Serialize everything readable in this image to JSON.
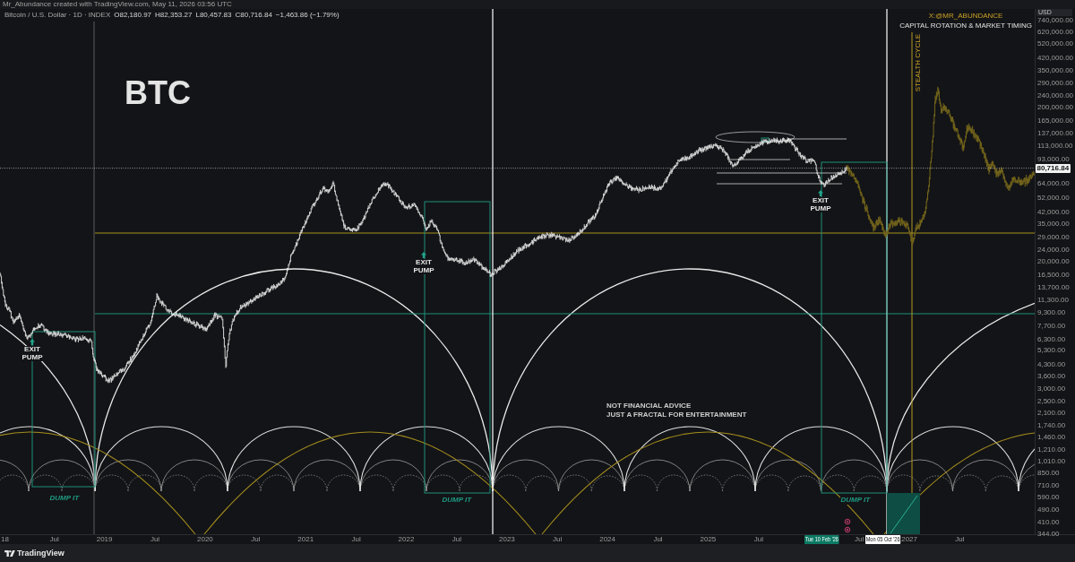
{
  "header": {
    "attribution": "Mr_Abundance created with TradingView.com, May 11, 2026 03:56 UTC"
  },
  "legend": {
    "symbol": "Bitcoin / U.S. Dollar · 1D · INDEX",
    "ohlc": [
      "O82,180.97",
      "H82,353.27",
      "L80,457.83",
      "C80,716.84"
    ],
    "change": "−1,463.86 (−1.79%)"
  },
  "chart": {
    "title": "BTC",
    "handle": "X:@MR_ABUNDANCE",
    "tagline": "CAPITAL ROTATION & MARKET TIMING",
    "cycle_label": "STEALTH CYCLE",
    "disclaimer": [
      "NOT FINANCIAL ADVICE",
      "JUST A FRACTAL FOR ENTERTAINMENT"
    ],
    "exit_signals": [
      {
        "text": "EXIT PUMP"
      },
      {
        "text": "EXIT PUMP"
      },
      {
        "text": "EXIT PUMP"
      }
    ],
    "dump_zones": [
      {
        "text": "DUMP IT"
      },
      {
        "text": "DUMP IT"
      },
      {
        "text": "DUMP IT"
      }
    ]
  },
  "price_axis": {
    "currency": "USD",
    "labels": [
      {
        "kind": "tick",
        "text": "740,000.00"
      },
      {
        "kind": "tick",
        "text": "620,000.00"
      },
      {
        "kind": "tick",
        "text": "520,000.00"
      },
      {
        "kind": "tick",
        "text": "420,000.00"
      },
      {
        "kind": "tick",
        "text": "350,000.00"
      },
      {
        "kind": "tick",
        "text": "290,000.00"
      },
      {
        "kind": "tick",
        "text": "240,000.00"
      },
      {
        "kind": "tick",
        "text": "200,000.00"
      },
      {
        "kind": "tick",
        "text": "165,000.00"
      },
      {
        "kind": "tick",
        "text": "137,000.00"
      },
      {
        "kind": "tick",
        "text": "113,000.00"
      },
      {
        "kind": "tick",
        "text": "93,000.00"
      },
      {
        "kind": "last",
        "text": "80,716.84"
      },
      {
        "kind": "tick",
        "text": "64,000.00"
      },
      {
        "kind": "tick",
        "text": "52,000.00"
      },
      {
        "kind": "tick",
        "text": "42,000.00"
      },
      {
        "kind": "tick",
        "text": "35,000.00"
      },
      {
        "kind": "tick",
        "text": "29,000.00"
      },
      {
        "kind": "tick",
        "text": "24,000.00"
      },
      {
        "kind": "tick",
        "text": "20,000.00"
      },
      {
        "kind": "tick",
        "text": "16,500.00"
      },
      {
        "kind": "tick",
        "text": "13,700.00"
      },
      {
        "kind": "tick",
        "text": "11,300.00"
      },
      {
        "kind": "tick",
        "text": "9,300.00"
      },
      {
        "kind": "tick",
        "text": "7,700.00"
      },
      {
        "kind": "tick",
        "text": "6,300.00"
      },
      {
        "kind": "tick",
        "text": "5,300.00"
      },
      {
        "kind": "tick",
        "text": "4,300.00"
      },
      {
        "kind": "tick",
        "text": "3,600.00"
      },
      {
        "kind": "tick",
        "text": "3,000.00"
      },
      {
        "kind": "tick",
        "text": "2,500.00"
      },
      {
        "kind": "tick",
        "text": "2,100.00"
      },
      {
        "kind": "tick",
        "text": "1,740.00"
      },
      {
        "kind": "tick",
        "text": "1,460.00"
      },
      {
        "kind": "tick",
        "text": "1,210.00"
      },
      {
        "kind": "tick",
        "text": "1,010.00"
      },
      {
        "kind": "tick",
        "text": "850.00"
      },
      {
        "kind": "tick",
        "text": "710.00"
      },
      {
        "kind": "tick",
        "text": "590.00"
      },
      {
        "kind": "tick",
        "text": "490.00"
      },
      {
        "kind": "tick",
        "text": "410.00"
      },
      {
        "kind": "tick",
        "text": "344.00"
      }
    ]
  },
  "time_axis": {
    "labels": [
      "18",
      "Jul",
      "2019",
      "Jul",
      "2020",
      "Jul",
      "2021",
      "Jul",
      "2022",
      "Jul",
      "2023",
      "Jul",
      "2024",
      "Jul",
      "2025",
      "Jul",
      "Jul",
      "2027",
      "Jul"
    ],
    "date_markers": [
      {
        "text": "Tue 10 Feb '26",
        "color": "#0c7a64"
      },
      {
        "text": "Mon 05 Oct '26",
        "color": "#ffffff"
      }
    ]
  },
  "footer": {
    "brand": "TradingView"
  }
}
